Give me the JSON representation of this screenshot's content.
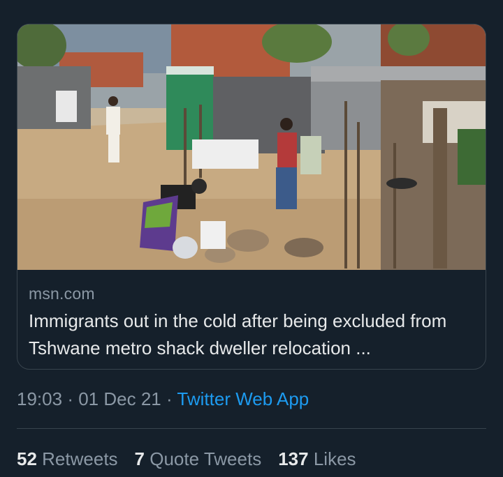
{
  "card": {
    "image_alt": "Informal settlement street scene",
    "domain": "msn.com",
    "title": "Immigrants out in the cold after being excluded from Tshwane metro shack dweller relocation ..."
  },
  "meta": {
    "time": "19:03",
    "separator": "·",
    "date": "01 Dec 21",
    "source": "Twitter Web App"
  },
  "stats": [
    {
      "count": "52",
      "label": "Retweets"
    },
    {
      "count": "7",
      "label": "Quote Tweets"
    },
    {
      "count": "137",
      "label": "Likes"
    }
  ],
  "colors": {
    "background": "#15202b",
    "link": "#1d9bf0",
    "muted": "#8b98a5",
    "border": "#38444d"
  }
}
